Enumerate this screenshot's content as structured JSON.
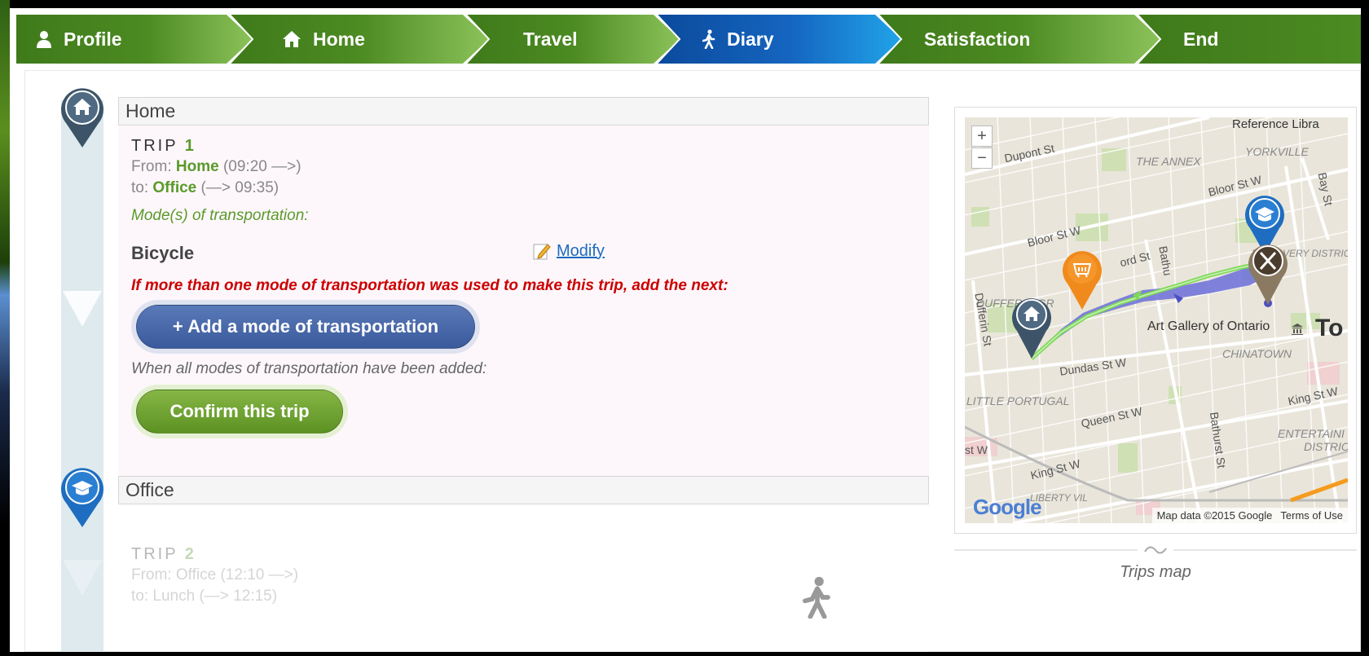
{
  "steps": [
    {
      "label": "Profile",
      "icon": "person-icon",
      "color": "#5a9a2a"
    },
    {
      "label": "Home",
      "icon": "home-icon",
      "color": "#5a9a2a"
    },
    {
      "label": "Travel",
      "icon": "",
      "color": "#5a9a2a"
    },
    {
      "label": "Diary",
      "icon": "walking-icon",
      "color": "#1a6bbf",
      "active": true
    },
    {
      "label": "Satisfaction",
      "icon": "",
      "color": "#5a9a2a"
    },
    {
      "label": "End",
      "icon": "",
      "color": "#5a9a2a"
    }
  ],
  "sections": [
    {
      "title": "Home",
      "icon": "home-icon"
    },
    {
      "title": "Office",
      "icon": "graduation-cap-icon"
    }
  ],
  "trip1": {
    "label": "TRIP",
    "number": "1",
    "from_label": "From:",
    "from_place": "Home",
    "from_time": "(09:20 —>)",
    "to_label": "to:",
    "to_place": "Office",
    "to_time": "(—> 09:35)",
    "modes_heading": "Mode(s) of transportation:",
    "mode": "Bicycle",
    "modify_label": "Modify",
    "more_modes_note": "If more than one mode of transportation was used to make this trip, add the next:",
    "add_mode_button": "+ Add a mode of transportation",
    "all_added_note": "When all modes of transportation have been added:",
    "confirm_button": "Confirm this trip"
  },
  "trip2": {
    "label": "TRIP",
    "number": "2",
    "from_label": "From:",
    "from_place": "Office",
    "from_time": "(12:10 —>)",
    "to_label": "to:",
    "to_place": "Lunch",
    "to_time": "(—> 12:15)",
    "mode_icon": "walking-icon"
  },
  "map": {
    "zoom_in": "+",
    "zoom_out": "−",
    "labels": {
      "dupont": "Dupont St",
      "annex": "THE ANNEX",
      "yorkville": "YORKVILLE",
      "reference_library": "Reference Libra",
      "bloor_w1": "Bloor St W",
      "bloor_w2": "Bloor St W",
      "bay": "Bay St",
      "harbord": "ord St",
      "bathurst_top": "Bathu",
      "dufferin_grove": "DUFFERIN GR",
      "dufferin": "Dufferin St",
      "discovery": "DISCOVERY DISTRICT",
      "art_gallery": "Art Gallery of Ontario",
      "to": "To",
      "chinatown": "CHINATOWN",
      "dundas": "Dundas St W",
      "little_portugal": "LITTLE PORTUGAL",
      "king_right": "King St W",
      "queen": "Queen St W",
      "bathurst": "Bathurst St",
      "entertainment": "ENTERTAINI",
      "district": "DISTRIC",
      "st_w": "st W",
      "king_left": "King St W",
      "liberty": "LIBERTY VIL"
    },
    "google": "Google",
    "attribution": "Map data ©2015 Google",
    "terms": "Terms of Use",
    "caption": "Trips map"
  },
  "colors": {
    "green": "#5a9a2a",
    "blue": "#1a6bbf",
    "red": "#cc0000"
  }
}
